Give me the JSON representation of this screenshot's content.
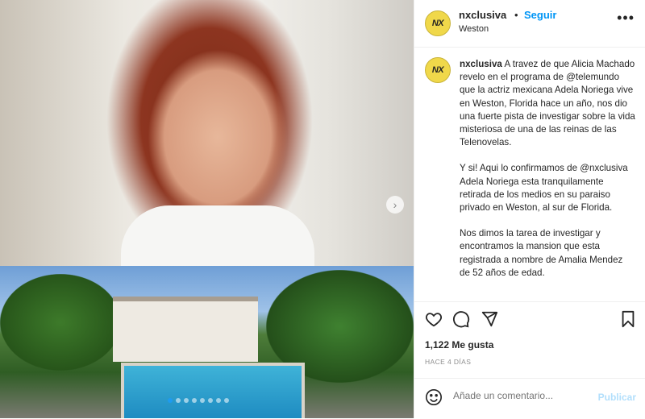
{
  "post": {
    "username": "nxclusiva",
    "follow_label": "Seguir",
    "dot": "•",
    "location": "Weston",
    "logo_text": "NX",
    "more_icon": "more-horizontal-icon"
  },
  "caption": {
    "username": "nxclusiva",
    "paragraph1": "A travez de que Alicia Machado revelo en el programa de @telemundo que la actriz mexicana Adela Noriega vive en Weston, Florida hace un año, nos dio una fuerte pista de investigar sobre la vida misteriosa de una de las reinas de las Telenovelas.",
    "paragraph2": "Y si! Aqui lo confirmamos de @nxclusiva Adela Noriega esta tranquilamente retirada de los medios en su paraiso privado en Weston, al sur de Florida.",
    "paragraph3": "Nos dimos la tarea de investigar y encontramos la mansion que esta registrada a nombre de Amalia Mendez de 52 años de edad."
  },
  "engagement": {
    "likes": "1,122 Me gusta",
    "timestamp": "HACE 4 DÍAS"
  },
  "comment": {
    "placeholder": "Añade un comentario...",
    "publish_label": "Publicar"
  },
  "carousel": {
    "total": 8,
    "active_index": 0,
    "accent": "#1e9bf0"
  },
  "colors": {
    "link": "#0095f6",
    "publish_disabled": "#b2dffc",
    "logo_bg": "#f0d84a"
  }
}
